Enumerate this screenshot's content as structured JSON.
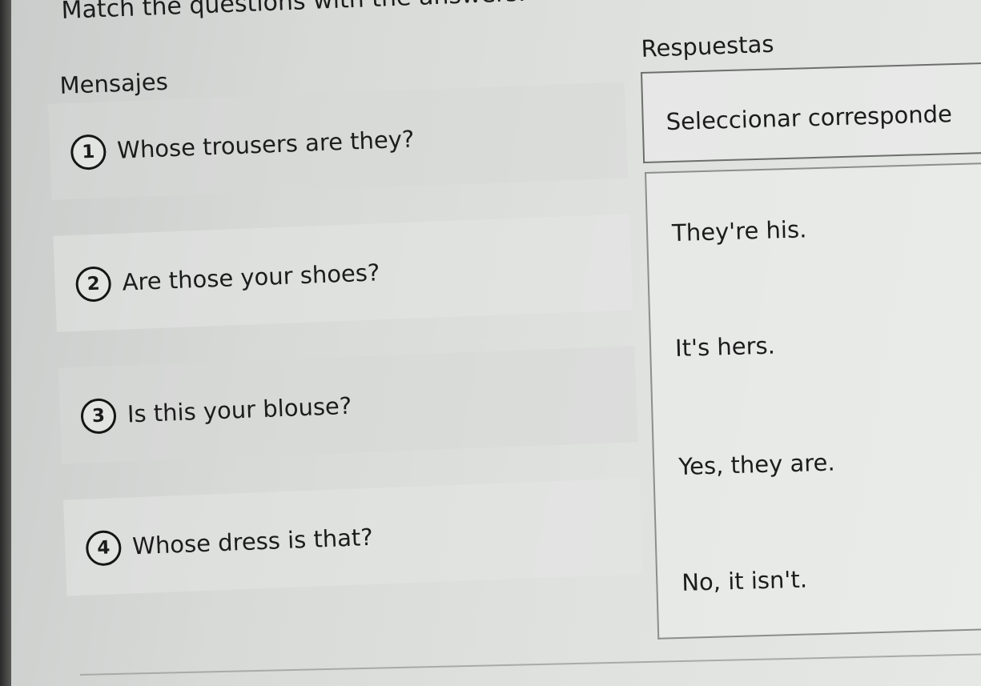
{
  "instruction": "Match the questions with the answers.",
  "left_header": "Mensajes",
  "right_header": "Respuestas",
  "select_placeholder": "Seleccionar corresponde",
  "questions": [
    {
      "number": "1",
      "text": "Whose trousers are they?"
    },
    {
      "number": "2",
      "text": "Are those your shoes?"
    },
    {
      "number": "3",
      "text": "Is this your blouse?"
    },
    {
      "number": "4",
      "text": "Whose dress is that?"
    }
  ],
  "answers": [
    "They're his.",
    "It's hers.",
    "Yes, they are.",
    "No, it isn't."
  ]
}
